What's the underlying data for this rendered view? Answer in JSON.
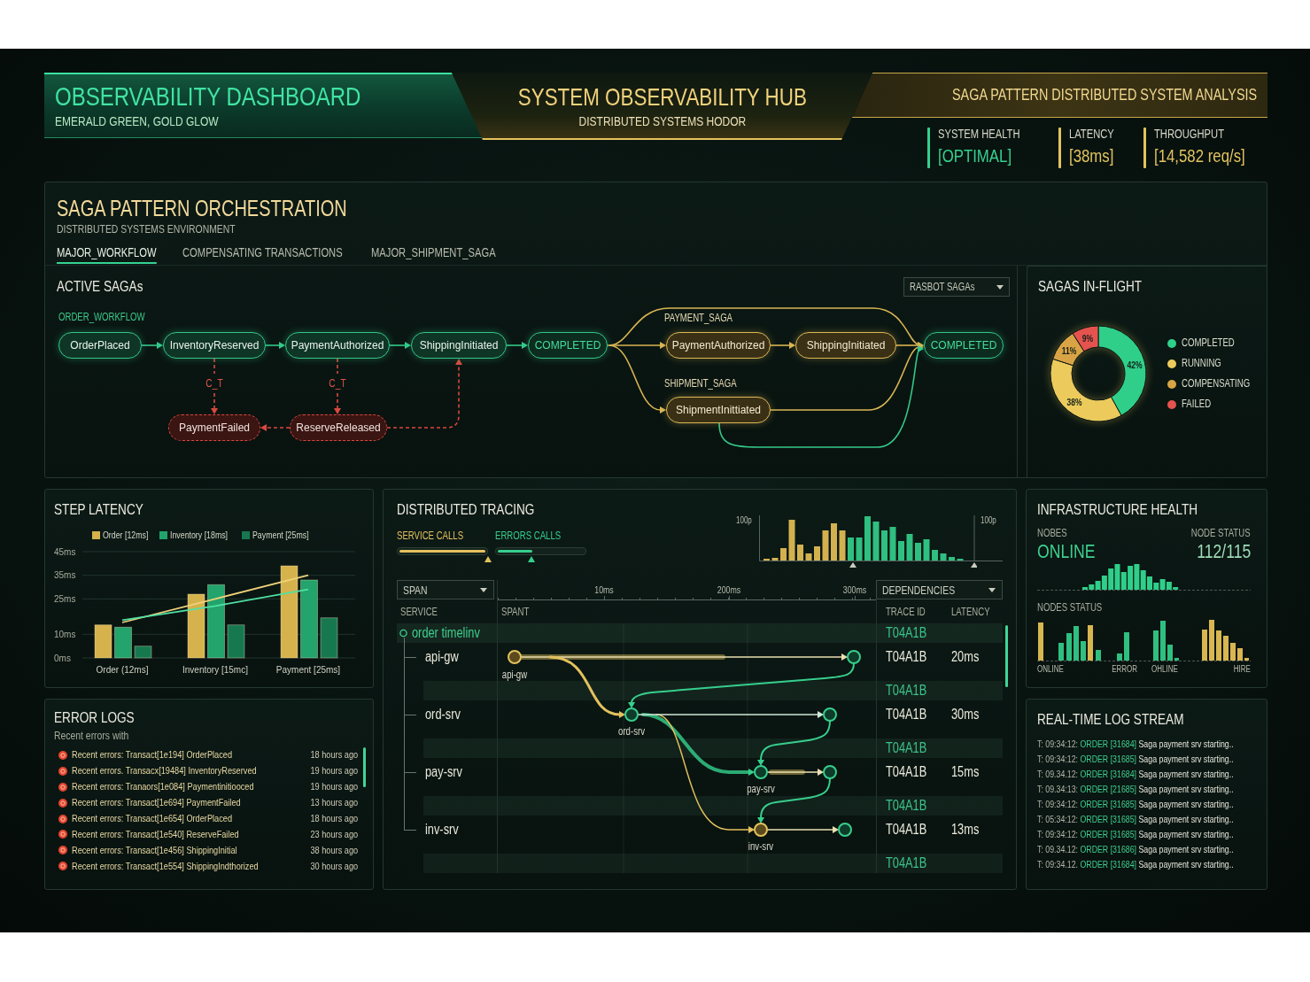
{
  "header": {
    "title": "OBSERVABILITY DASHBOARD",
    "subtitle": "EMERALD GREEN, GOLD GLOW",
    "hub_title": "SYSTEM OBSERVABILITY HUB",
    "hub_subtitle": "DISTRIBUTED SYSTEMS HODOR",
    "analysis_title": "SAGA PATTERN DISTRIBUTED SYSTEM ANALYSIS",
    "stats": [
      {
        "label": "SYSTEM HEALTH",
        "value": "[OPTIMAL]",
        "color": "#36d08e"
      },
      {
        "label": "LATENCY",
        "value": "[38ms]",
        "color": "#e3c35f"
      },
      {
        "label": "THROUGHPUT",
        "value": "[14,582 req/s]",
        "color": "#e3c35f"
      }
    ]
  },
  "orchestration": {
    "title": "SAGA PATTERN ORCHESTRATION",
    "subtitle": "DISTRIBUTED SYSTEMS ENVIRONMENT",
    "tabs": [
      {
        "label": "MAJOR_WORKFLOW",
        "selected": true
      },
      {
        "label": "COMPENSATING TRANSACTIONS",
        "selected": false
      },
      {
        "label": "MAJOR_SHIPMENT_SAGA",
        "selected": false
      }
    ],
    "active_sagas": {
      "title": "ACTIVE SAGAs",
      "filter": "RASBOT SAGAs",
      "group_labels": [
        {
          "text": "ORDER_WORKFLOW",
          "kind": "main"
        },
        {
          "text": "PAYMENT_SAGA",
          "kind": "branch"
        },
        {
          "text": "SHIPMENT_SAGA",
          "kind": "branch"
        }
      ],
      "nodes": [
        {
          "label": "OrderPlaced",
          "kind": "step"
        },
        {
          "label": "InventoryReserved",
          "kind": "step"
        },
        {
          "label": "PaymentAuthorized",
          "kind": "step"
        },
        {
          "label": "ShippingInitiated",
          "kind": "step"
        },
        {
          "label": "COMPLETED",
          "kind": "done"
        },
        {
          "label": "PaymentAuthorized",
          "kind": "branch"
        },
        {
          "label": "ShippingInitiated",
          "kind": "branch"
        },
        {
          "label": "COMPLETED",
          "kind": "done"
        },
        {
          "label": "ShipmentInittiated",
          "kind": "branch"
        },
        {
          "label": "PaymentFailed",
          "kind": "compensation"
        },
        {
          "label": "ReserveReleased",
          "kind": "compensation"
        }
      ],
      "edge_labels": [
        "C_T",
        "C_T"
      ]
    },
    "in_flight": {
      "title": "SAGAS IN-FLIGHT",
      "chart_data": {
        "type": "donut",
        "categories": [
          "COMPLETED",
          "RUNNING",
          "COMPENSATING",
          "FAILED"
        ],
        "values": [
          42,
          38,
          11,
          9
        ],
        "colors": [
          "#2fcf8a",
          "#eccb5c",
          "#d9a445",
          "#e5534f"
        ],
        "value_labels": [
          "42%",
          "38%",
          "11%",
          "9%"
        ]
      }
    }
  },
  "step_latency": {
    "title": "STEP LATENCY",
    "chart_data": {
      "type": "bar",
      "categories": [
        "Order (12ms]",
        "Inventory [15mc]",
        "Payment [25ms]"
      ],
      "series": [
        {
          "name": "Order [12ms]",
          "color": "#d6b24c",
          "values": [
            14,
            27,
            39
          ]
        },
        {
          "name": "Inventory [18ms]",
          "color": "#22a46c",
          "values": [
            13,
            31,
            33
          ]
        },
        {
          "name": "Payment [25ms]",
          "color": "#17784f",
          "values": [
            5,
            14,
            17
          ]
        },
        {
          "type": "line",
          "color": "#efd27a",
          "values": [
            15,
            25,
            35
          ]
        },
        {
          "type": "line",
          "color": "#4fe0a4",
          "values": [
            16,
            22,
            29
          ]
        }
      ],
      "ylim": [
        0,
        45
      ],
      "yticks": [
        {
          "value": 0,
          "label": "0ms"
        },
        {
          "value": 10,
          "label": "10ms"
        },
        {
          "value": 25,
          "label": "25ms"
        },
        {
          "value": 35,
          "label": "35ms"
        },
        {
          "value": 45,
          "label": "45ms"
        }
      ],
      "grid": true
    }
  },
  "error_logs": {
    "title": "ERROR LOGS",
    "subtitle": "Recent errors with",
    "items": [
      {
        "text": "Recent errors: Transact[1e194] OrderPlaced",
        "time": "18 hours ago"
      },
      {
        "text": "Recent errors. Transacx[19484] InventoryReserved",
        "time": "19 hours ago"
      },
      {
        "text": "Recent errors: Tranaors[1e084] Paymentinitiooced",
        "time": "19 hours ago"
      },
      {
        "text": "Recent errors: Transact[1e694] PaymentFailed",
        "time": "13 hours ago"
      },
      {
        "text": "Recent errors: Transact[1e654] OrderPlaced",
        "time": "18 hours ago"
      },
      {
        "text": "Recent errors: Transact[1e540] ReserveFailed",
        "time": "23 hours ago"
      },
      {
        "text": "Recent errors: Transact[1e456] ShippingInitial",
        "time": "38 hours ago"
      },
      {
        "text": "Recent errors: Transact[1e554] ShippingIndthorized",
        "time": "30 hours ago"
      }
    ]
  },
  "tracing": {
    "title": "DISTRIBUTED TRACING",
    "meters": [
      {
        "label": "SERVICE CALLS",
        "level": 1,
        "color": "#e3c15e"
      },
      {
        "label": "ERRORS CALLS",
        "level": 0.4,
        "color": "#36cf8d"
      }
    ],
    "histogram_labels": [
      "100p",
      "100p"
    ],
    "span_filter": "SPAN",
    "dependencies_filter": "DEPENDENCIES",
    "ruler_labels": [
      "10ms",
      "200ms",
      "300ms"
    ],
    "columns": [
      "SERVICE",
      "SPANT",
      "TRACE ID",
      "LATENCY"
    ],
    "rows": [
      {
        "kind": "root",
        "service": "order timelinv",
        "trace_id": "T04A1B"
      },
      {
        "kind": "span",
        "service": "api-gw",
        "node_label": "api-gw",
        "trace_id": "T04A1B",
        "latency": "20ms"
      },
      {
        "kind": "gap",
        "trace_id": "T04A1B"
      },
      {
        "kind": "span",
        "service": "ord-srv",
        "node_label": "ord-srv",
        "trace_id": "T04A1B",
        "latency": "30ms"
      },
      {
        "kind": "gap",
        "trace_id": "T04A1B"
      },
      {
        "kind": "span",
        "service": "pay-srv",
        "node_label": "pay-srv",
        "trace_id": "T04A1B",
        "latency": "15ms"
      },
      {
        "kind": "gap",
        "trace_id": "T04A1B"
      },
      {
        "kind": "span",
        "service": "inv-srv",
        "node_label": "inv-srv",
        "trace_id": "T04A1B",
        "latency": "13ms"
      },
      {
        "kind": "gap",
        "trace_id": "T04A1B"
      }
    ]
  },
  "infra": {
    "title": "INFRASTRUCTURE HEALTH",
    "nodes_label": "NOBES",
    "nodes_value": "ONLINE",
    "status_label": "NODE STATUS",
    "status_value": "112/115",
    "chart_title": "NODES STATUS",
    "chart_labels": [
      "ONLINE",
      "ERROR",
      "OHLINE",
      "HIRE"
    ]
  },
  "log_stream": {
    "title": "REAL-TIME LOG STREAM",
    "lines": [
      {
        "time": "T: 09:34:12:",
        "tag": "ORDER [31684]",
        "message": "Saga payment srv starting.."
      },
      {
        "time": "T: 09:34:12:",
        "tag": "ORDER [31685]",
        "message": "Saga payment srv starting.."
      },
      {
        "time": "T: 09.34.12:",
        "tag": "ORDER [31684]",
        "message": "Saga payment srv starting.."
      },
      {
        "time": "T: 09.34:13:",
        "tag": "ORDER [21685]",
        "message": "Saga payment srv starting.."
      },
      {
        "time": "T: 09:34:12:",
        "tag": "ORDER [31685]",
        "message": "Saga payment srv starting.."
      },
      {
        "time": "T: 05:34:12:",
        "tag": "ORDER [31685]",
        "message": "Saga payment srv starting.."
      },
      {
        "time": "T: 09:34:12:",
        "tag": "ORDER [31685]",
        "message": "Saga payment srv starting.."
      },
      {
        "time": "T: 09.34.12:",
        "tag": "ORDER [31686]",
        "message": "Saga payment srv starting.."
      },
      {
        "time": "T: 09:34.12.",
        "tag": "ORDER [31684]",
        "message": "Saga payment srv starting.."
      }
    ]
  }
}
